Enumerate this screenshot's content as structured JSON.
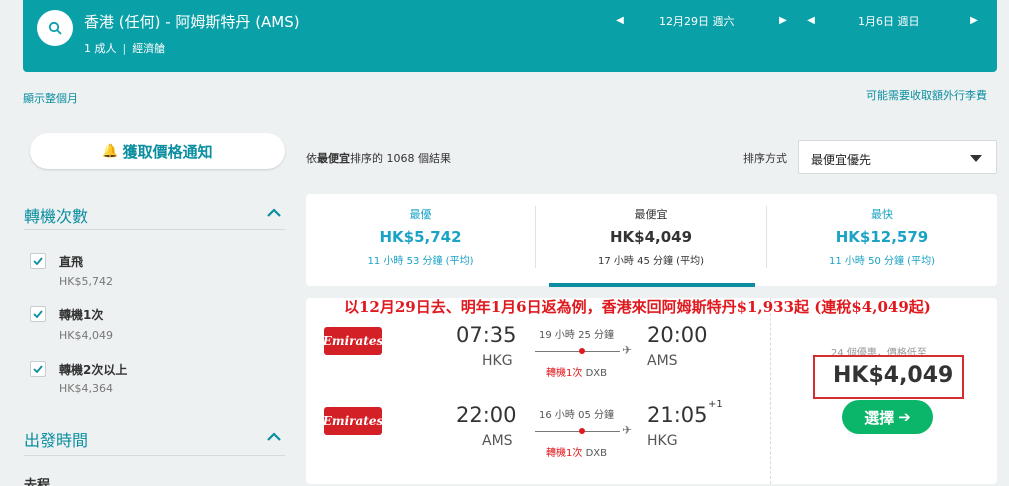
{
  "header": {
    "route": "香港 (任何) - 阿姆斯特丹 (AMS)",
    "passengers": "1 成人",
    "cabin": "經濟艙",
    "depart_date": "12月29日 週六",
    "return_date": "1月6日 週日"
  },
  "links": {
    "show_month": "顯示整個月",
    "extra_fees": "可能需要收取額外行李費"
  },
  "sidebar": {
    "price_alert": "獲取價格通知",
    "stops_title": "轉機次數",
    "stops": [
      {
        "label": "直飛",
        "price": "HK$5,742"
      },
      {
        "label": "轉機1次",
        "price": "HK$4,049"
      },
      {
        "label": "轉機2次以上",
        "price": "HK$4,364"
      }
    ],
    "departure_title": "出發時間",
    "outbound_label": "去程"
  },
  "results": {
    "count_prefix": "依",
    "count_bold": "最便宜",
    "count_suffix": "排序的 1068 個結果",
    "sort_label": "排序方式",
    "sort_value": "最便宜優先"
  },
  "tabs": [
    {
      "title": "最優",
      "price": "HK$5,742",
      "duration": "11 小時 53 分鐘 (平均)"
    },
    {
      "title": "最便宜",
      "price": "HK$4,049",
      "duration": "17 小時 45 分鐘 (平均)"
    },
    {
      "title": "最快",
      "price": "HK$12,579",
      "duration": "11 小時 50 分鐘 (平均)"
    }
  ],
  "banner": "以12月29日去、明年1月6日返為例，香港來回阿姆斯特丹$1,933起 (連稅$4,049起)",
  "card": {
    "legs": [
      {
        "airline": "Emirates",
        "dep_time": "07:35",
        "dep_code": "HKG",
        "duration": "19 小時 25 分鐘",
        "stops": "轉機1次",
        "via": "DXB",
        "arr_time": "20:00",
        "arr_code": "AMS",
        "plus_day": ""
      },
      {
        "airline": "Emirates",
        "dep_time": "22:00",
        "dep_code": "AMS",
        "duration": "16 小時 05 分鐘",
        "stops": "轉機1次",
        "via": "DXB",
        "arr_time": "21:05",
        "arr_code": "HKG",
        "plus_day": "+1"
      }
    ],
    "deals": "24 個優惠，價格低至",
    "price": "HK$4,049",
    "select": "選擇"
  },
  "colors": {
    "header": "#0aa0a8",
    "accent": "#0a8ea0",
    "highlight_red": "#e0191e",
    "select_green": "#0bb56a",
    "emirates_red": "#d31f26"
  }
}
